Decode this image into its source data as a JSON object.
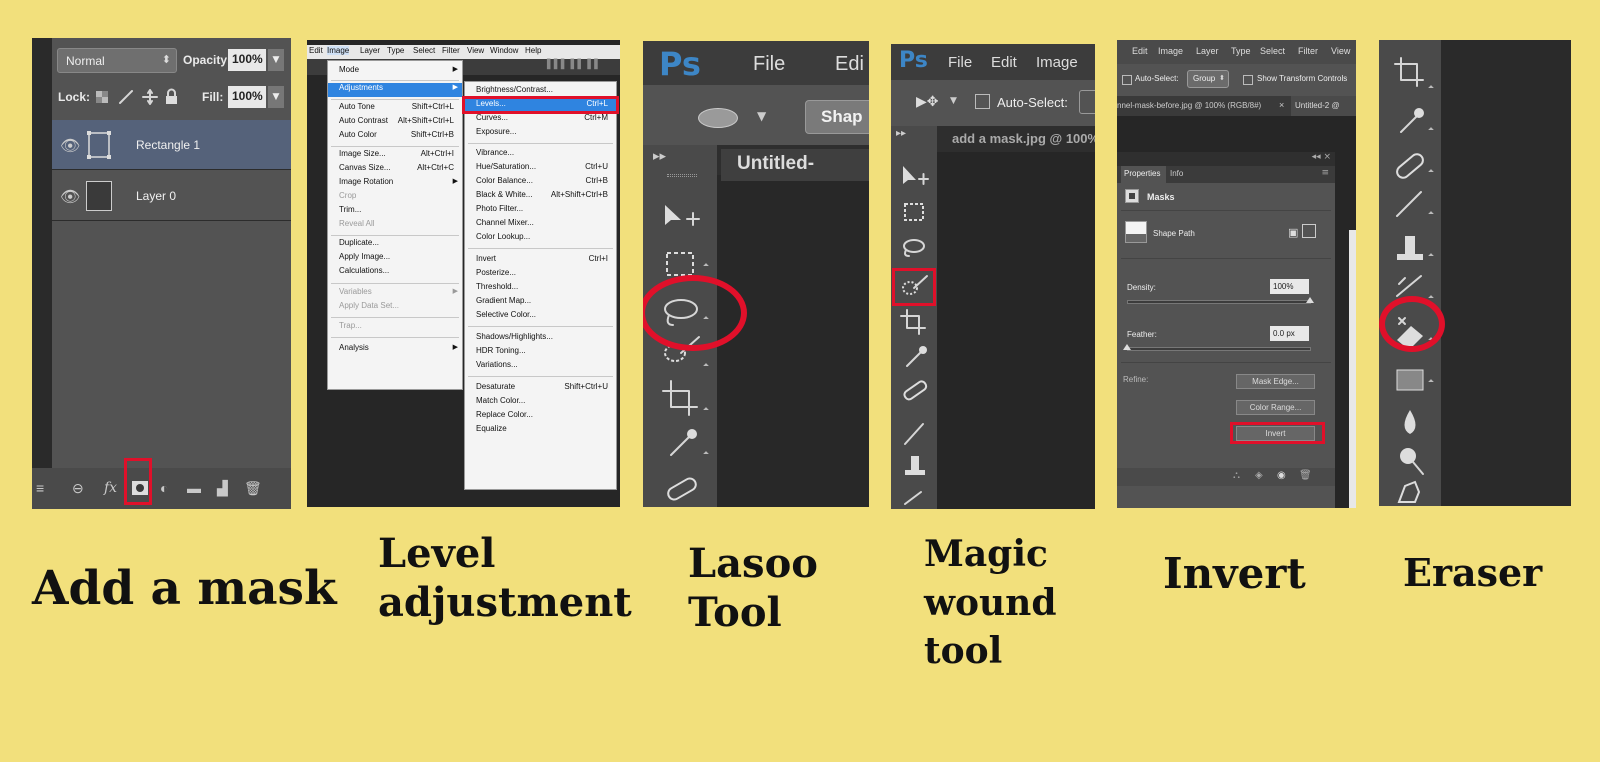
{
  "panel1": {
    "blend_mode": "Normal",
    "opacity_label": "Opacity:",
    "opacity_value": "100%",
    "lock_label": "Lock:",
    "fill_label": "Fill:",
    "fill_value": "100%",
    "layers": [
      "Rectangle 1",
      "Layer 0"
    ],
    "fx_label": "fx"
  },
  "panel2": {
    "menubar": [
      "Edit",
      "Image",
      "Layer",
      "Type",
      "Select",
      "Filter",
      "View",
      "Window",
      "Help"
    ],
    "image_menu": [
      {
        "label": "Mode",
        "shortcut": ""
      },
      {
        "label": "Adjustments",
        "shortcut": ""
      },
      {
        "label": "Auto Tone",
        "shortcut": "Shift+Ctrl+L"
      },
      {
        "label": "Auto Contrast",
        "shortcut": "Alt+Shift+Ctrl+L"
      },
      {
        "label": "Auto Color",
        "shortcut": "Shift+Ctrl+B"
      },
      {
        "label": "Image Size...",
        "shortcut": "Alt+Ctrl+I"
      },
      {
        "label": "Canvas Size...",
        "shortcut": "Alt+Ctrl+C"
      },
      {
        "label": "Image Rotation",
        "shortcut": ""
      },
      {
        "label": "Crop",
        "shortcut": ""
      },
      {
        "label": "Trim...",
        "shortcut": ""
      },
      {
        "label": "Reveal All",
        "shortcut": ""
      },
      {
        "label": "Duplicate...",
        "shortcut": ""
      },
      {
        "label": "Apply Image...",
        "shortcut": ""
      },
      {
        "label": "Calculations...",
        "shortcut": ""
      },
      {
        "label": "Variables",
        "shortcut": ""
      },
      {
        "label": "Apply Data Set...",
        "shortcut": ""
      },
      {
        "label": "Trap...",
        "shortcut": ""
      },
      {
        "label": "Analysis",
        "shortcut": ""
      }
    ],
    "adjustments_menu": [
      {
        "label": "Brightness/Contrast...",
        "shortcut": ""
      },
      {
        "label": "Levels...",
        "shortcut": "Ctrl+L"
      },
      {
        "label": "Curves...",
        "shortcut": "Ctrl+M"
      },
      {
        "label": "Exposure...",
        "shortcut": ""
      },
      {
        "label": "Vibrance...",
        "shortcut": ""
      },
      {
        "label": "Hue/Saturation...",
        "shortcut": "Ctrl+U"
      },
      {
        "label": "Color Balance...",
        "shortcut": "Ctrl+B"
      },
      {
        "label": "Black & White...",
        "shortcut": "Alt+Shift+Ctrl+B"
      },
      {
        "label": "Photo Filter...",
        "shortcut": ""
      },
      {
        "label": "Channel Mixer...",
        "shortcut": ""
      },
      {
        "label": "Color Lookup...",
        "shortcut": ""
      },
      {
        "label": "Invert",
        "shortcut": "Ctrl+I"
      },
      {
        "label": "Posterize...",
        "shortcut": ""
      },
      {
        "label": "Threshold...",
        "shortcut": ""
      },
      {
        "label": "Gradient Map...",
        "shortcut": ""
      },
      {
        "label": "Selective Color...",
        "shortcut": ""
      },
      {
        "label": "Shadows/Highlights...",
        "shortcut": ""
      },
      {
        "label": "HDR Toning...",
        "shortcut": ""
      },
      {
        "label": "Variations...",
        "shortcut": ""
      },
      {
        "label": "Desaturate",
        "shortcut": "Shift+Ctrl+U"
      },
      {
        "label": "Match Color...",
        "shortcut": ""
      },
      {
        "label": "Replace Color...",
        "shortcut": ""
      },
      {
        "label": "Equalize",
        "shortcut": ""
      }
    ]
  },
  "panel3": {
    "ps_logo": "Ps",
    "menu_file": "File",
    "menu_edit_partial": "Edi",
    "shape_button": "Shap",
    "doc_tab": "Untitled-"
  },
  "panel4": {
    "ps_logo": "Ps",
    "menus": [
      "File",
      "Edit",
      "Image"
    ],
    "auto_select": "Auto-Select:",
    "doc_tab": "add a mask.jpg @ 100%"
  },
  "panel5": {
    "menubar": [
      "Edit",
      "Image",
      "Layer",
      "Type",
      "Select",
      "Filter",
      "View"
    ],
    "auto_select": "Auto-Select:",
    "group_value": "Group",
    "show_transform": "Show Transform Controls",
    "doc_tab_1": "nnel-mask-before.jpg @ 100% (RGB/8#)",
    "doc_tab_2": "Untitled-2 @",
    "tab_properties": "Properties",
    "tab_info": "Info",
    "masks_title": "Masks",
    "shape_path": "Shape Path",
    "density_label": "Density:",
    "density_value": "100%",
    "feather_label": "Feather:",
    "feather_value": "0.0 px",
    "refine_label": "Refine:",
    "mask_edge_button": "Mask Edge...",
    "color_range_button": "Color Range...",
    "invert_button": "Invert"
  },
  "captions": {
    "add_mask": "Add a mask",
    "level_line1": "Level",
    "level_line2": "adjustment",
    "lasoo_line1": "Lasoo",
    "lasoo_line2": "Tool",
    "magic_line1": "Magic",
    "magic_line2": "wound",
    "magic_line3": "tool",
    "invert": "Invert",
    "eraser": "Eraser"
  },
  "colors": {
    "background": "#f2e07c",
    "highlight_red": "#e0102a",
    "ps_blue": "#3d86c6",
    "menu_selected": "#2f84e0"
  }
}
